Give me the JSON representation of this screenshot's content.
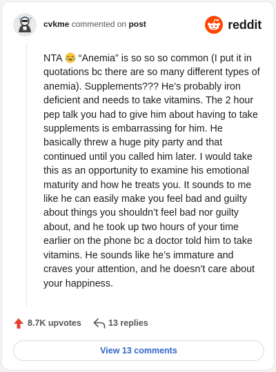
{
  "header": {
    "username": "cvkme",
    "action_text": "commented on",
    "post_link": "post",
    "brand_word": "reddit"
  },
  "comment": {
    "text_before_emoji": "NTA",
    "emoji": "crying-laughing-emoji",
    "text_after_emoji": "“Anemia” is so so so common (I put it in quotations bc there are so many different types of anemia). Supplements??? He’s probably iron deficient and needs to take vitamins. The 2 hour pep talk you had to give him about having to take supplements is embarrassing for him. He basically threw a huge pity party and that continued until you called him later. I would take this as an opportunity to examine his emotional maturity and how he treats you. It sounds to me like he can easily make you feel bad and guilty about things you shouldn’t feel bad nor guilty about, and he took up two hours of your time earlier on the phone bc a doctor told him to take vitamins. He sounds like he’s immature and craves your attention, and he doesn’t care about your happiness."
  },
  "actions": {
    "upvotes": "8.7K upvotes",
    "replies": "13 replies",
    "upvote_icon": "upvote-arrow-icon",
    "reply_icon": "reply-arrow-icon"
  },
  "footer": {
    "view_comments_label": "View 13 comments"
  },
  "colors": {
    "reddit_orange": "#ff4500",
    "link_blue": "#2f64c8",
    "upvote_red": "#e5412d"
  }
}
